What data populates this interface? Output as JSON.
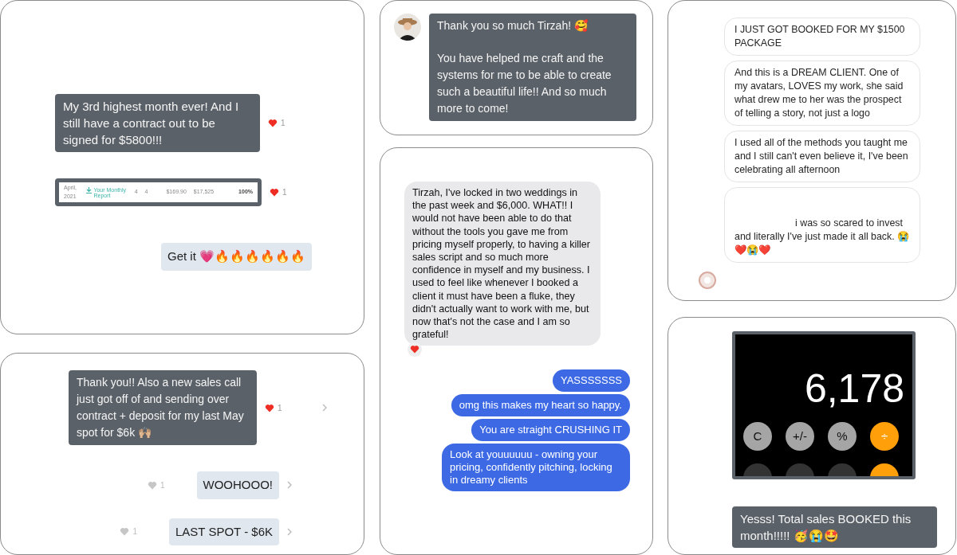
{
  "columns": [
    [
      {
        "kind": "tiktok",
        "messages": [
          {
            "kind": "received",
            "text": "My 3rd highest month ever! And I still have a contract out to be signed for $5800!!!",
            "reaction": {
              "liked": true,
              "count": "1"
            }
          },
          {
            "kind": "report",
            "cells": [
              "April, 2021",
              "Your Monthly Report",
              "4",
              "4",
              "$169.90",
              "$17,525",
              "100%"
            ],
            "reaction": {
              "liked": true,
              "count": "1"
            }
          },
          {
            "kind": "sent",
            "text": "Get it 💗🔥🔥🔥🔥🔥🔥"
          }
        ]
      },
      {
        "kind": "tiktok",
        "messages": [
          {
            "kind": "received",
            "text": "Thank you!! Also a new sales call just got off of and sending over contract + deposit for my last May spot for $6k 🙌🏼",
            "reaction": {
              "liked": true,
              "count": "1"
            },
            "chevron": true
          },
          {
            "kind": "sent",
            "text": "WOOHOOO!",
            "reaction": {
              "liked": false,
              "count": "1"
            },
            "chevron": true
          },
          {
            "kind": "sent",
            "text": "LAST SPOT - $6K",
            "reaction": {
              "liked": false,
              "count": "1"
            },
            "chevron": true
          }
        ]
      }
    ],
    [
      {
        "kind": "avatar_chat",
        "messages": [
          {
            "kind": "received",
            "paragraphs": [
              "Thank you so much Tirzah! 🥰",
              "You have helped me craft and the systems for me to be able to create such a beautiful life!! And so much more to come!"
            ]
          }
        ]
      },
      {
        "kind": "imessage",
        "messages": [
          {
            "kind": "received",
            "text": "Tirzah, I've locked in two weddings in the past week and $6,000. WHAT!! I would not have been able to do that without the tools you gave me from pricing myself properly, to having a killer sales script and so much more confidence in myself and my business. I used to feel like whenever I booked a client it must have been a fluke, they didn't actually want to work with me, but now that's not the case and I am so grateful!",
            "tapback": true
          },
          {
            "kind": "sent",
            "text": "YASSSSSSS"
          },
          {
            "kind": "sent",
            "text": "omg this makes my heart so happy."
          },
          {
            "kind": "sent",
            "text": "You are straight CRUSHING IT"
          },
          {
            "kind": "sent",
            "text": "Look at youuuuuu - owning your pricing, confidently pitching, locking in dreamy clients"
          }
        ]
      }
    ],
    [
      {
        "kind": "instagram",
        "messages": [
          {
            "kind": "received",
            "text": "I JUST GOT BOOKED FOR MY $1500 PACKAGE"
          },
          {
            "kind": "received",
            "text": "And this is a DREAM CLIENT. One of my avatars, LOVES my work, she said what drew me to her was the prospect of telling a story, not just a logo"
          },
          {
            "kind": "received",
            "text": "I used all of the methods you taught me and I still can't even believe it, I've been celebrating all afternoon"
          },
          {
            "kind": "received",
            "text": "i was so scared to invest and literally I've just made it all back. 😭❤️😭❤️",
            "redacted_start": true
          }
        ]
      },
      {
        "kind": "tiktok",
        "messages": [
          {
            "kind": "calculator",
            "display": "6,178",
            "keys": [
              {
                "kind": "function",
                "label": "C"
              },
              {
                "kind": "function",
                "label": "+/-"
              },
              {
                "kind": "function",
                "label": "%"
              },
              {
                "kind": "operator",
                "label": "÷"
              },
              {
                "kind": "digit"
              },
              {
                "kind": "digit"
              },
              {
                "kind": "digit"
              },
              {
                "kind": "operator"
              }
            ]
          },
          {
            "kind": "received",
            "text": "Yesss! Total sales BOOKED this month!!!!! 🥳😭🤩"
          }
        ]
      }
    ]
  ]
}
